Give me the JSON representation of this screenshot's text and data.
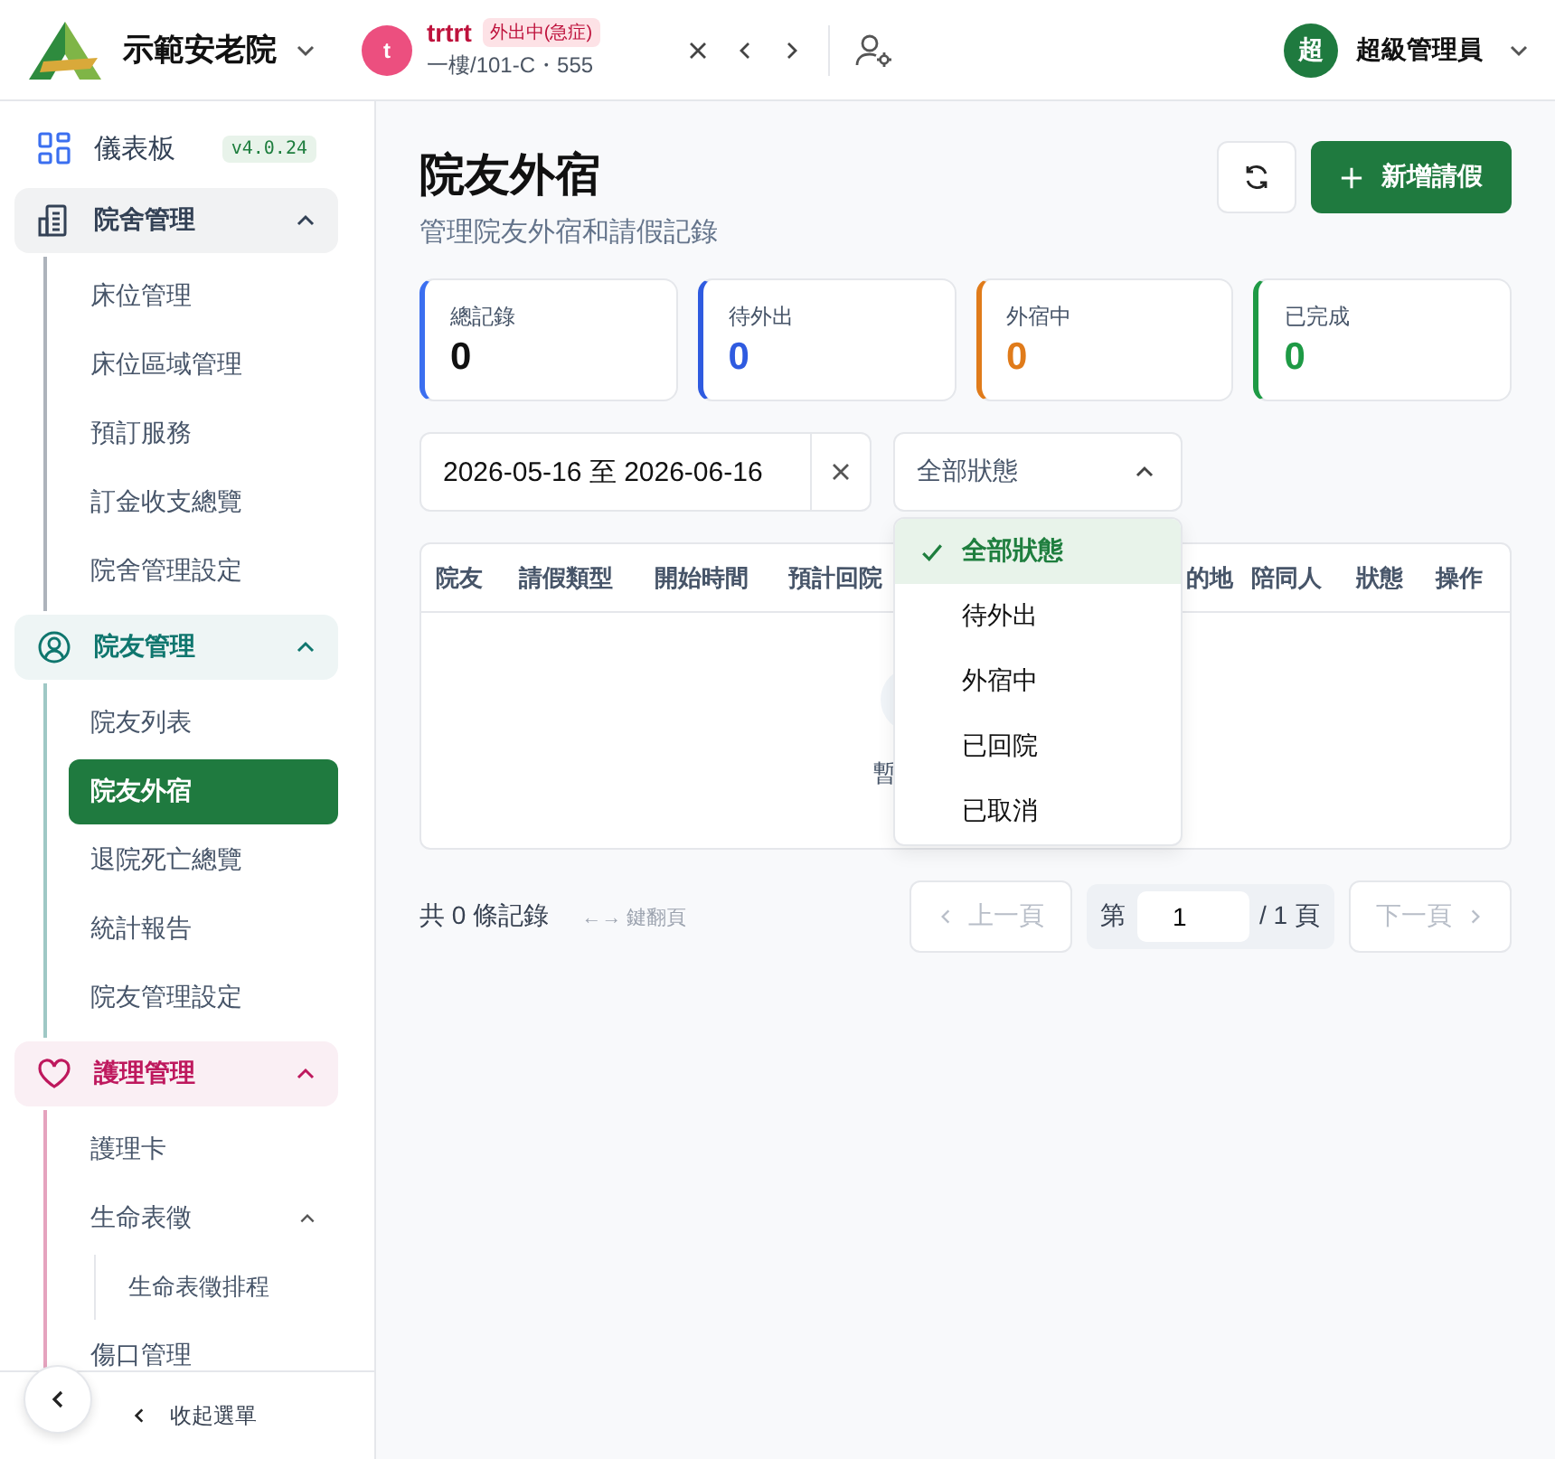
{
  "topbar": {
    "org_name": "示範安老院",
    "resident": {
      "avatar_letter": "t",
      "name": "trtrt",
      "status_badge": "外出中(急症)",
      "location": "一樓/101-C・555"
    },
    "user": {
      "avatar_letter": "超",
      "name": "超級管理員"
    }
  },
  "sidebar": {
    "items": [
      {
        "kind": "link",
        "label": "儀表板",
        "badge": "v4.0.24"
      },
      {
        "kind": "group",
        "label": "院舍管理",
        "color": "#334155",
        "expanded": true,
        "children": [
          {
            "label": "床位管理",
            "selected": false
          },
          {
            "label": "床位區域管理",
            "selected": false
          },
          {
            "label": "預訂服務",
            "selected": false
          },
          {
            "label": "訂金收支總覽",
            "selected": false
          },
          {
            "label": "院舍管理設定",
            "selected": false
          }
        ]
      },
      {
        "kind": "group",
        "label": "院友管理",
        "color": "#0f766e",
        "expanded": true,
        "children": [
          {
            "label": "院友列表",
            "selected": false
          },
          {
            "label": "院友外宿",
            "selected": true
          },
          {
            "label": "退院死亡總覽",
            "selected": false
          },
          {
            "label": "統計報告",
            "selected": false
          },
          {
            "label": "院友管理設定",
            "selected": false
          }
        ]
      },
      {
        "kind": "group",
        "label": "護理管理",
        "color": "#be185d",
        "expanded": true,
        "children": [
          {
            "label": "護理卡",
            "selected": false
          },
          {
            "label": "生命表徵",
            "selected": false,
            "expanded": true,
            "children": [
              {
                "label": "生命表徵排程",
                "selected": false
              }
            ]
          },
          {
            "label": "傷口管理",
            "selected": false
          }
        ]
      }
    ],
    "collapse_label": "收起選單"
  },
  "page": {
    "title": "院友外宿",
    "subtitle": "管理院友外宿和請假記錄",
    "add_button": "新增請假"
  },
  "stats": [
    {
      "label": "總記錄",
      "value": "0",
      "color": "#3b6ff0",
      "kind": "neutral"
    },
    {
      "label": "待外出",
      "value": "0",
      "color": "#2f5be0",
      "kind": "accent"
    },
    {
      "label": "外宿中",
      "value": "0",
      "color": "#e07b1a",
      "kind": "accent"
    },
    {
      "label": "已完成",
      "value": "0",
      "color": "#1e9a45",
      "kind": "accent"
    }
  ],
  "filters": {
    "date_range": "2026-05-16 至 2026-06-16",
    "status": "全部狀態",
    "status_open": true,
    "options": [
      {
        "label": "全部狀態",
        "selected": true
      },
      {
        "label": "待外出",
        "selected": false
      },
      {
        "label": "外宿中",
        "selected": false
      },
      {
        "label": "已回院",
        "selected": false
      },
      {
        "label": "已取消",
        "selected": false
      }
    ]
  },
  "table": {
    "columns": [
      "院友",
      "請假類型",
      "開始時間",
      "預計回院",
      "的地",
      "陪同人",
      "狀態",
      "操作"
    ],
    "empty_text": "暫"
  },
  "pagination": {
    "total_text": "共 0 條記錄",
    "hint": "←→ 鍵翻頁",
    "prev": "上一頁",
    "prev_disabled": true,
    "page_prefix": "第",
    "page": "1",
    "page_suffix": "/ 1 頁",
    "next": "下一頁",
    "next_disabled": true
  }
}
